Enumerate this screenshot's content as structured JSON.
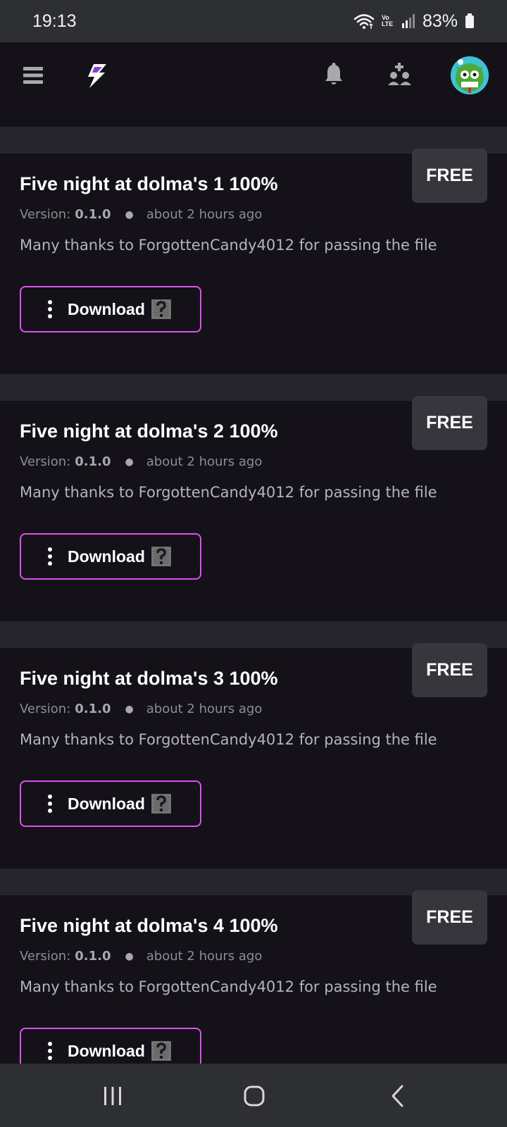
{
  "status_bar": {
    "time": "19:13",
    "battery_percent": "83%",
    "network_label": "Vo LTE",
    "icons": [
      "wifi-icon",
      "volte-icon",
      "signal-icon",
      "battery-icon"
    ]
  },
  "header": {
    "icons": [
      "menu-icon",
      "logo-icon",
      "bell-icon",
      "add-friend-icon",
      "avatar"
    ]
  },
  "colors": {
    "accent": "#e04ef0",
    "background": "#141218",
    "separator": "#27252c",
    "badge": "#38363d"
  },
  "cards": [
    {
      "title": "Five night at dolma's 1 100%",
      "version_label": "Version:",
      "version": "0.1.0",
      "time_ago": "about 2 hours ago",
      "description": "Many thanks to ForgottenCandy4012 for passing the file",
      "price": "FREE",
      "download_label": "Download"
    },
    {
      "title": "Five night at dolma's 2 100%",
      "version_label": "Version:",
      "version": "0.1.0",
      "time_ago": "about 2 hours ago",
      "description": "Many thanks to ForgottenCandy4012 for passing the file",
      "price": "FREE",
      "download_label": "Download"
    },
    {
      "title": "Five night at dolma's 3 100%",
      "version_label": "Version:",
      "version": "0.1.0",
      "time_ago": "about 2 hours ago",
      "description": "Many thanks to ForgottenCandy4012 for passing the file",
      "price": "FREE",
      "download_label": "Download"
    },
    {
      "title": "Five night at dolma's 4 100%",
      "version_label": "Version:",
      "version": "0.1.0",
      "time_ago": "about 2 hours ago",
      "description": "Many thanks to ForgottenCandy4012 for passing the file",
      "price": "FREE",
      "download_label": "Download"
    }
  ],
  "nav_bar": {
    "buttons": [
      "recent-apps-icon",
      "home-icon",
      "back-icon"
    ]
  }
}
